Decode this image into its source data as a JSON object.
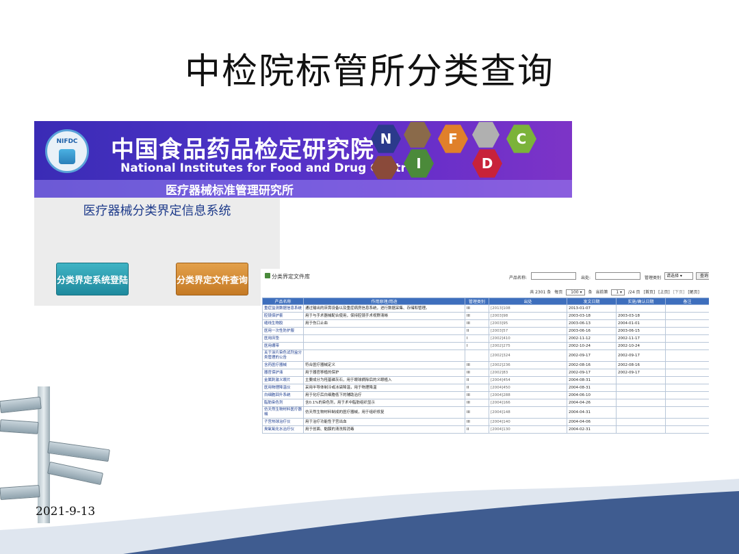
{
  "slide": {
    "title": "中检院标管所分类查询",
    "date": "2021-9-13"
  },
  "banner": {
    "logo_text": "NIFDC",
    "title_cn": "中国食品药品检定研究院",
    "title_en": "National Institutes for Food and Drug Control",
    "subtitle": "医疗器械标准管理研究所",
    "hex_letters": [
      "N",
      "I",
      "F",
      "D",
      "C"
    ]
  },
  "panel": {
    "title": "医疗器械分类界定信息系统",
    "login_button": "分类界定系统登陆",
    "query_button": "分类界定文件查询"
  },
  "doc_library": {
    "title": "分类界定文件库",
    "product_label": "产品名称:",
    "source_label": "出处:",
    "category_label": "管理类别",
    "category_select": "请选择",
    "query_button": "查询",
    "pager": {
      "total": "共 2301 条",
      "per_page_label": "每页",
      "per_page": "100",
      "unit": "条",
      "current_label": "当前第",
      "current": "1",
      "pages": "/24 页",
      "first": "[首页]",
      "prev": "[上页]",
      "next": "[下页]",
      "last": "[尾页]"
    },
    "columns": [
      "产品名称",
      "作用原理/用途",
      "管理类别",
      "出处",
      "发文日期",
      "实施/确认日期",
      "备注"
    ],
    "rows": [
      [
        "重症监测数据信息系统",
        "通过输出的床旁设备以及重症病房信息系统，进行数据采集、存储和管理。",
        "III",
        "[2013]108",
        "2013-01-07",
        "",
        ""
      ],
      [
        "腔镜保护套",
        "用于与手术器械配合使用，保持腔镜手术视野清晰",
        "III",
        "[2003]98",
        "2003-03-18",
        "2003-03-18",
        ""
      ],
      [
        "缝线生物胶",
        "用于伤口止血",
        "III",
        "[2003]95",
        "2003-06-13",
        "2004-01-01",
        ""
      ],
      [
        "医用一次性防护服",
        "",
        "II",
        "[2003]57",
        "2003-06-16",
        "2003-06-15",
        ""
      ],
      [
        "医用床垫",
        "",
        "I",
        "[2002]410",
        "2002-11-12",
        "2002-11-17",
        ""
      ],
      [
        "医用绷带",
        "",
        "I",
        "[2002]275",
        "2002-10-24",
        "2002-10-24",
        ""
      ],
      [
        "关于涂片染色试剂盒分类管理的公告",
        "",
        "",
        "[2002]324",
        "2002-09-17",
        "2002-09-17",
        ""
      ],
      [
        "含药医疗器械",
        "符合医疗器械定义",
        "III",
        "[2002]236",
        "2002-08-16",
        "2002-08-16",
        ""
      ],
      [
        "器官保护液",
        "用于器官移植的保护",
        "III",
        "[2002]83",
        "2002-09-17",
        "2002-09-17",
        ""
      ],
      [
        "金属刺激义眼片",
        "主要成分为羟基磷灰石，用于眼球摘除后的义眼植入",
        "II",
        "[2004]454",
        "2004-08-31",
        "",
        ""
      ],
      [
        "医用物理降温仪",
        "采用半导体制冷或冰袋降温，用于物理降温",
        "II",
        "[2004]450",
        "2004-08-31",
        "",
        ""
      ],
      [
        "白细胞回升系统",
        "用于化疗后白细胞低下的辅助治疗",
        "III",
        "[2004]288",
        "2004-06-10",
        "",
        ""
      ],
      [
        "脂肪染色剂",
        "含0.1%的染色剂，用于术中脂肪组织显示",
        "III",
        "[2004]166",
        "2004-04-26",
        "",
        ""
      ],
      [
        "仿天然生物材料医疗器械",
        "仿天然生物材料制成的医疗器械，用于组织修复",
        "III",
        "[2004]148",
        "2004-04-31",
        "",
        ""
      ],
      [
        "子宫热球治疗仪",
        "用于治疗功能性子宫出血",
        "III",
        "[2004]140",
        "2004-04-06",
        "",
        ""
      ],
      [
        "臭氧氧化水治疗仪",
        "用于创面、黏膜的清洗和消毒",
        "II",
        "[2004]130",
        "2004-02-31",
        "",
        ""
      ]
    ]
  }
}
